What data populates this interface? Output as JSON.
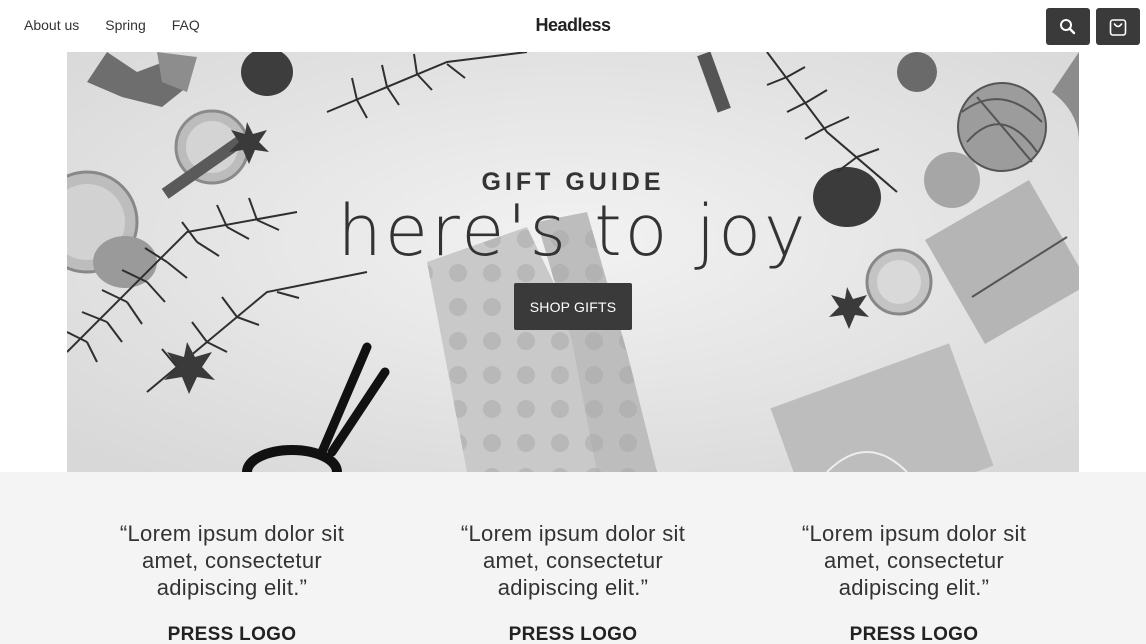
{
  "header": {
    "nav": [
      "About us",
      "Spring",
      "FAQ"
    ],
    "brand": "Headless",
    "search_icon": "search-icon",
    "cart_icon": "shopping-bag-icon"
  },
  "hero": {
    "eyebrow": "GIFT GUIDE",
    "headline": "here's to joy",
    "cta": "SHOP GIFTS"
  },
  "press": [
    {
      "quote": "“Lorem ipsum dolor sit amet, consectetur adipiscing elit.”",
      "logo": "PRESS LOGO"
    },
    {
      "quote": "“Lorem ipsum dolor sit amet, consectetur adipiscing elit.”",
      "logo": "PRESS LOGO"
    },
    {
      "quote": "“Lorem ipsum dolor sit amet, consectetur adipiscing elit.”",
      "logo": "PRESS LOGO"
    }
  ],
  "colors": {
    "button_bg": "#3a3a3a",
    "press_bg": "#f4f4f4"
  }
}
